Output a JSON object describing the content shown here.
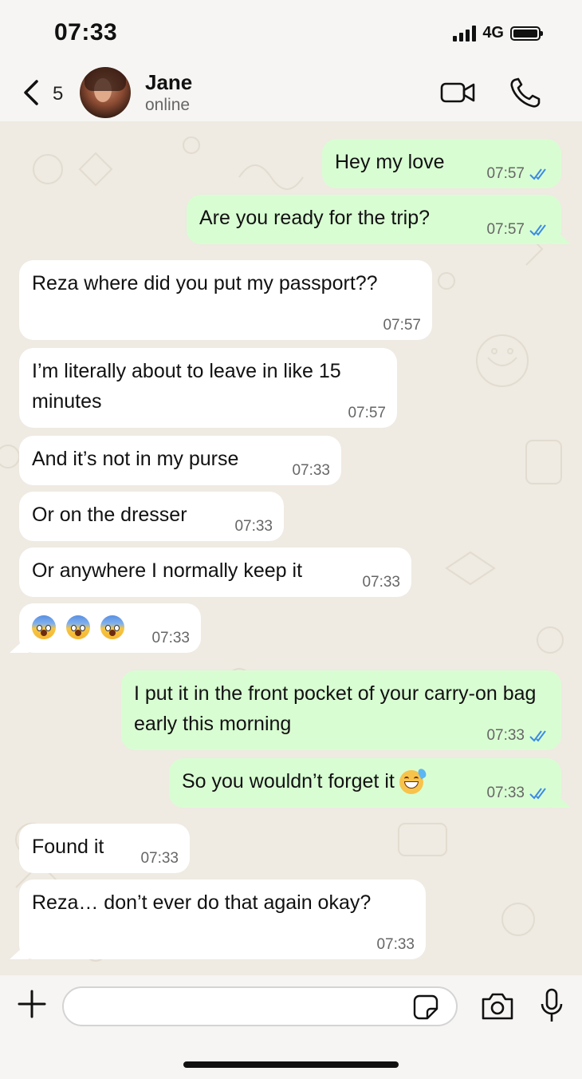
{
  "status_bar": {
    "time": "07:33",
    "network": "4G",
    "signal_icon": "signal-bars-icon",
    "battery_icon": "battery-icon"
  },
  "header": {
    "back_icon": "chevron-left-icon",
    "back_count": "5",
    "contact_name": "Jane",
    "contact_status": "online",
    "video_icon": "video-camera-icon",
    "call_icon": "phone-icon"
  },
  "messages": [
    {
      "dir": "out",
      "text": "Hey my love",
      "time": "07:57",
      "ticks": "double-check"
    },
    {
      "dir": "out",
      "text": "Are you ready for the trip?",
      "time": "07:57",
      "ticks": "double-check"
    },
    {
      "dir": "in",
      "text": "Reza where did you put my passport??",
      "time": "07:57"
    },
    {
      "dir": "in",
      "text": "I’m literally about to leave in like 15 minutes",
      "time": "07:57"
    },
    {
      "dir": "in",
      "text": "And it’s not in my purse",
      "time": "07:33"
    },
    {
      "dir": "in",
      "text": "Or on the dresser",
      "time": "07:33"
    },
    {
      "dir": "in",
      "text": "Or anywhere I normally keep it",
      "time": "07:33"
    },
    {
      "dir": "in",
      "text": "",
      "emoji": [
        "face-screaming-in-fear",
        "face-screaming-in-fear",
        "face-screaming-in-fear"
      ],
      "time": "07:33"
    },
    {
      "dir": "out",
      "text": "I put it in the front pocket of your carry-on bag early this morning",
      "time": "07:33",
      "ticks": "double-check"
    },
    {
      "dir": "out",
      "text": "So you wouldn’t forget it",
      "emoji": [
        "grinning-face-with-sweat"
      ],
      "time": "07:33",
      "ticks": "double-check"
    },
    {
      "dir": "in",
      "text": "Found it",
      "time": "07:33"
    },
    {
      "dir": "in",
      "text": "Reza… don’t ever do that again okay?",
      "time": "07:33"
    }
  ],
  "composer": {
    "add_icon": "plus-icon",
    "input_value": "",
    "input_placeholder": "",
    "sticker_icon": "sticker-icon",
    "camera_icon": "camera-icon",
    "mic_icon": "microphone-icon"
  },
  "colors": {
    "incoming_bubble": "#ffffff",
    "outgoing_bubble": "#d9fdd3",
    "read_ticks": "#3b8be6",
    "chat_background": "#efeae2"
  }
}
